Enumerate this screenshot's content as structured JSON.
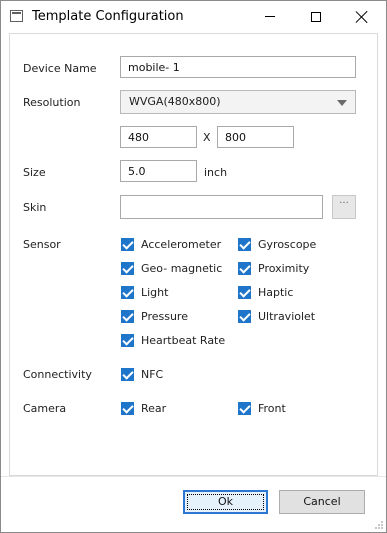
{
  "window": {
    "title": "Template Configuration"
  },
  "form": {
    "device_name": {
      "label": "Device Name",
      "value": "mobile- 1"
    },
    "resolution": {
      "label": "Resolution",
      "selected": "WVGA(480x800)",
      "width": "480",
      "separator": "X",
      "height": "800"
    },
    "size": {
      "label": "Size",
      "value": "5.0",
      "unit": "inch"
    },
    "skin": {
      "label": "Skin",
      "value": "",
      "browse_label": "···"
    },
    "sensor": {
      "label": "Sensor",
      "items": [
        {
          "label": "Accelerometer",
          "checked": true
        },
        {
          "label": "Gyroscope",
          "checked": true
        },
        {
          "label": "Geo- magnetic",
          "checked": true
        },
        {
          "label": "Proximity",
          "checked": true
        },
        {
          "label": "Light",
          "checked": true
        },
        {
          "label": "Haptic",
          "checked": true
        },
        {
          "label": "Pressure",
          "checked": true
        },
        {
          "label": "Ultraviolet",
          "checked": true
        },
        {
          "label": "Heartbeat Rate",
          "checked": true
        }
      ]
    },
    "connectivity": {
      "label": "Connectivity",
      "items": [
        {
          "label": "NFC",
          "checked": true
        }
      ]
    },
    "camera": {
      "label": "Camera",
      "items": [
        {
          "label": "Rear",
          "checked": true
        },
        {
          "label": "Front",
          "checked": true
        }
      ]
    }
  },
  "buttons": {
    "ok": "Ok",
    "cancel": "Cancel"
  },
  "colors": {
    "accent": "#1f75c9",
    "focus_border": "#2b77d1"
  }
}
